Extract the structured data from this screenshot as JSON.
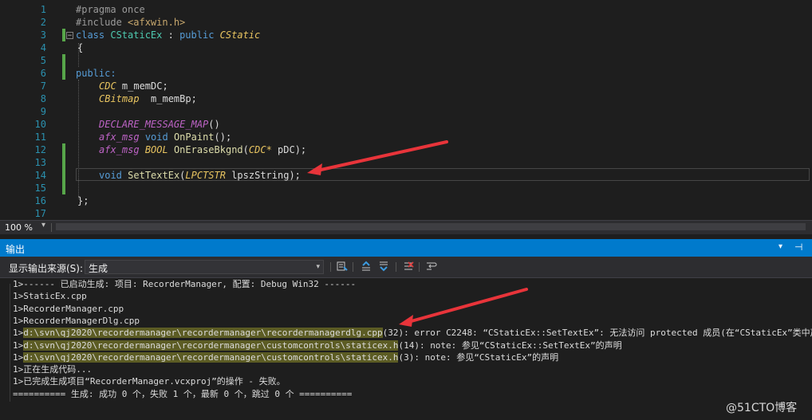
{
  "editor": {
    "line_numbers": [
      "1",
      "2",
      "3",
      "4",
      "5",
      "6",
      "7",
      "8",
      "9",
      "10",
      "11",
      "12",
      "13",
      "14",
      "15",
      "16",
      "17"
    ],
    "code": {
      "l1": "#pragma once",
      "l2a": "#include ",
      "l2b": "<afxwin.h>",
      "l3_fold": "−",
      "l3a": "class ",
      "l3b": "CStaticEx",
      "l3c": " : ",
      "l3d": "public",
      "l3e": " ",
      "l3f": "CStatic",
      "l4": "{",
      "l6": "public:",
      "l7a": "CDC",
      "l7b": " m_memDC;",
      "l8a": "CBitmap",
      "l8b": "  m_memBp;",
      "l10a": "DECLARE_MESSAGE_MAP",
      "l10b": "()",
      "l11a": "afx_msg",
      "l11b": " ",
      "l11c": "void",
      "l11d": " ",
      "l11e": "OnPaint",
      "l11f": "();",
      "l12a": "afx_msg",
      "l12b": " ",
      "l12c": "BOOL",
      "l12d": " ",
      "l12e": "OnEraseBkgnd",
      "l12f": "(",
      "l12g": "CDC*",
      "l12h": " pDC);",
      "l14a": "void",
      "l14b": " ",
      "l14c": "SetTextEx",
      "l14d": "(",
      "l14e": "LPCTSTR",
      "l14f": " lpszString);",
      "l16": "};"
    }
  },
  "zoom_bar": {
    "zoom": "100 %",
    "dropdown": "▾"
  },
  "output": {
    "title": "输出",
    "title_dropdown": "▾",
    "title_pin": "⊣",
    "source_label": "显示输出来源(S):",
    "source_value": "生成",
    "source_arrow": "▾",
    "lines": {
      "o1": "1>------ 已启动生成: 项目: RecorderManager, 配置: Debug Win32 ------",
      "o2": "1>StaticEx.cpp",
      "o3": "1>RecorderManager.cpp",
      "o4": "1>RecorderManagerDlg.cpp",
      "o5a": "1>",
      "o5b": "d:\\svn\\qj2020\\recordermanager\\recordermanager\\recordermanagerdlg.cpp",
      "o5c": "(32): error C2248: “CStaticEx::SetTextEx”: 无法访问 protected 成员(在“CStaticEx”类中声明)",
      "o6a": "1>",
      "o6b": "d:\\svn\\qj2020\\recordermanager\\recordermanager\\customcontrols\\staticex.h",
      "o6c": "(14): note: 参见“CStaticEx::SetTextEx”的声明",
      "o7a": "1>",
      "o7b": "d:\\svn\\qj2020\\recordermanager\\recordermanager\\customcontrols\\staticex.h",
      "o7c": "(3): note: 参见“CStaticEx”的声明",
      "o8": "1>正在生成代码...",
      "o9": "1>已完成生成项目“RecorderManager.vcxproj”的操作 - 失败。",
      "o10": "========== 生成: 成功 0 个，失败 1 个，最新 0 个，跳过 0 个 =========="
    }
  },
  "watermark": "@51CTO博客",
  "colors": {
    "accent": "#007acc",
    "annotation_arrow": "#e8343a",
    "change_marker": "#57a64a"
  }
}
